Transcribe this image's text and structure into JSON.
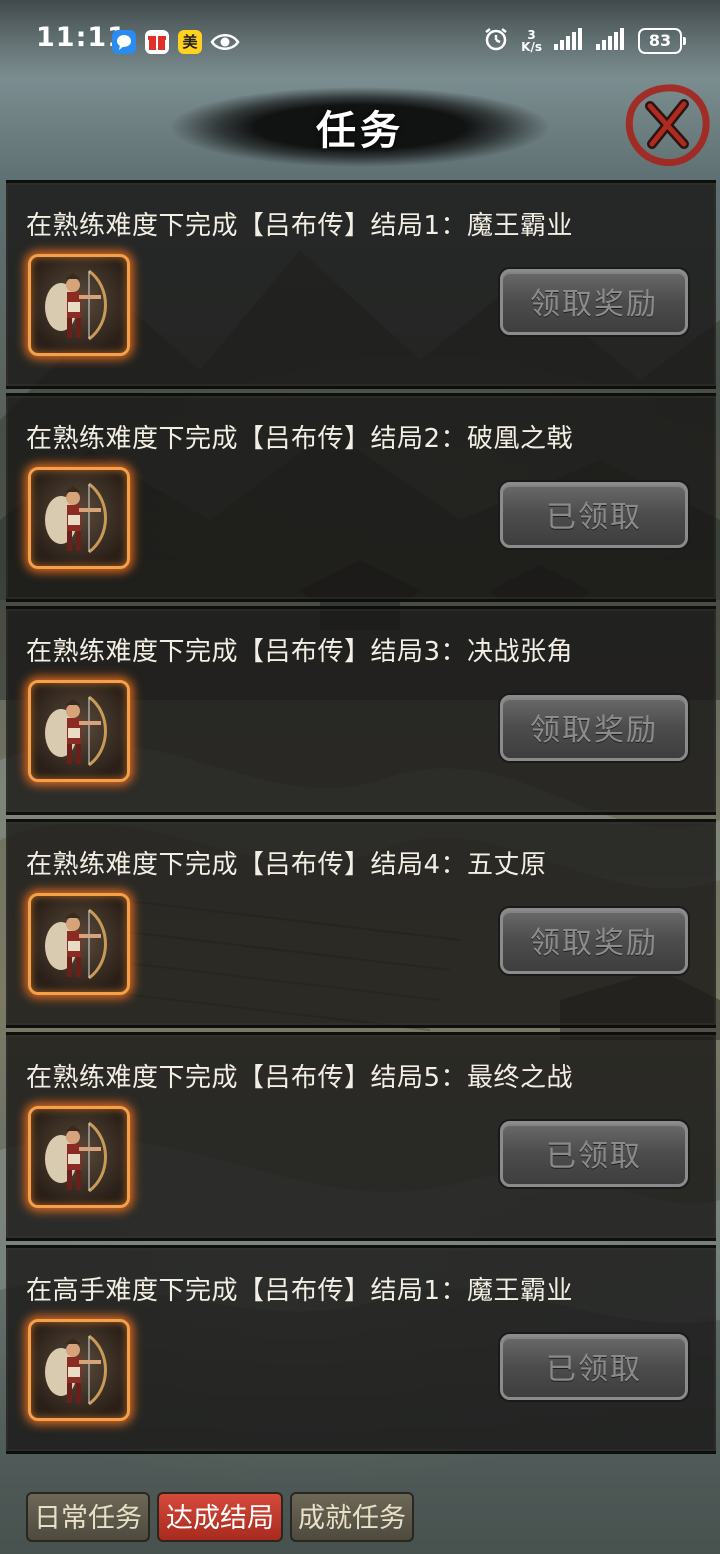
{
  "status_bar": {
    "time": "11:11",
    "app_badge_meituan": "美",
    "net_speed_value": "3",
    "net_speed_unit": "K/s",
    "battery": "83"
  },
  "header": {
    "title": "任务"
  },
  "tasks": [
    {
      "title": "在熟练难度下完成【吕布传】结局1：魔王霸业",
      "button_label": "领取奖励",
      "status": "unclaimed"
    },
    {
      "title": "在熟练难度下完成【吕布传】结局2：破凰之戟",
      "button_label": "已领取",
      "status": "claimed"
    },
    {
      "title": "在熟练难度下完成【吕布传】结局3：决战张角",
      "button_label": "领取奖励",
      "status": "unclaimed"
    },
    {
      "title": "在熟练难度下完成【吕布传】结局4：五丈原",
      "button_label": "领取奖励",
      "status": "unclaimed"
    },
    {
      "title": "在熟练难度下完成【吕布传】结局5：最终之战",
      "button_label": "已领取",
      "status": "claimed"
    },
    {
      "title": "在高手难度下完成【吕布传】结局1：魔王霸业",
      "button_label": "已领取",
      "status": "claimed"
    }
  ],
  "tabs": [
    {
      "label": "日常任务",
      "active": false
    },
    {
      "label": "达成结局",
      "active": true
    },
    {
      "label": "成就任务",
      "active": false
    }
  ],
  "colors": {
    "tab_active": "#c23a2c",
    "tab_inactive": "#5d5849",
    "icon_glow": "#f6a04a"
  }
}
